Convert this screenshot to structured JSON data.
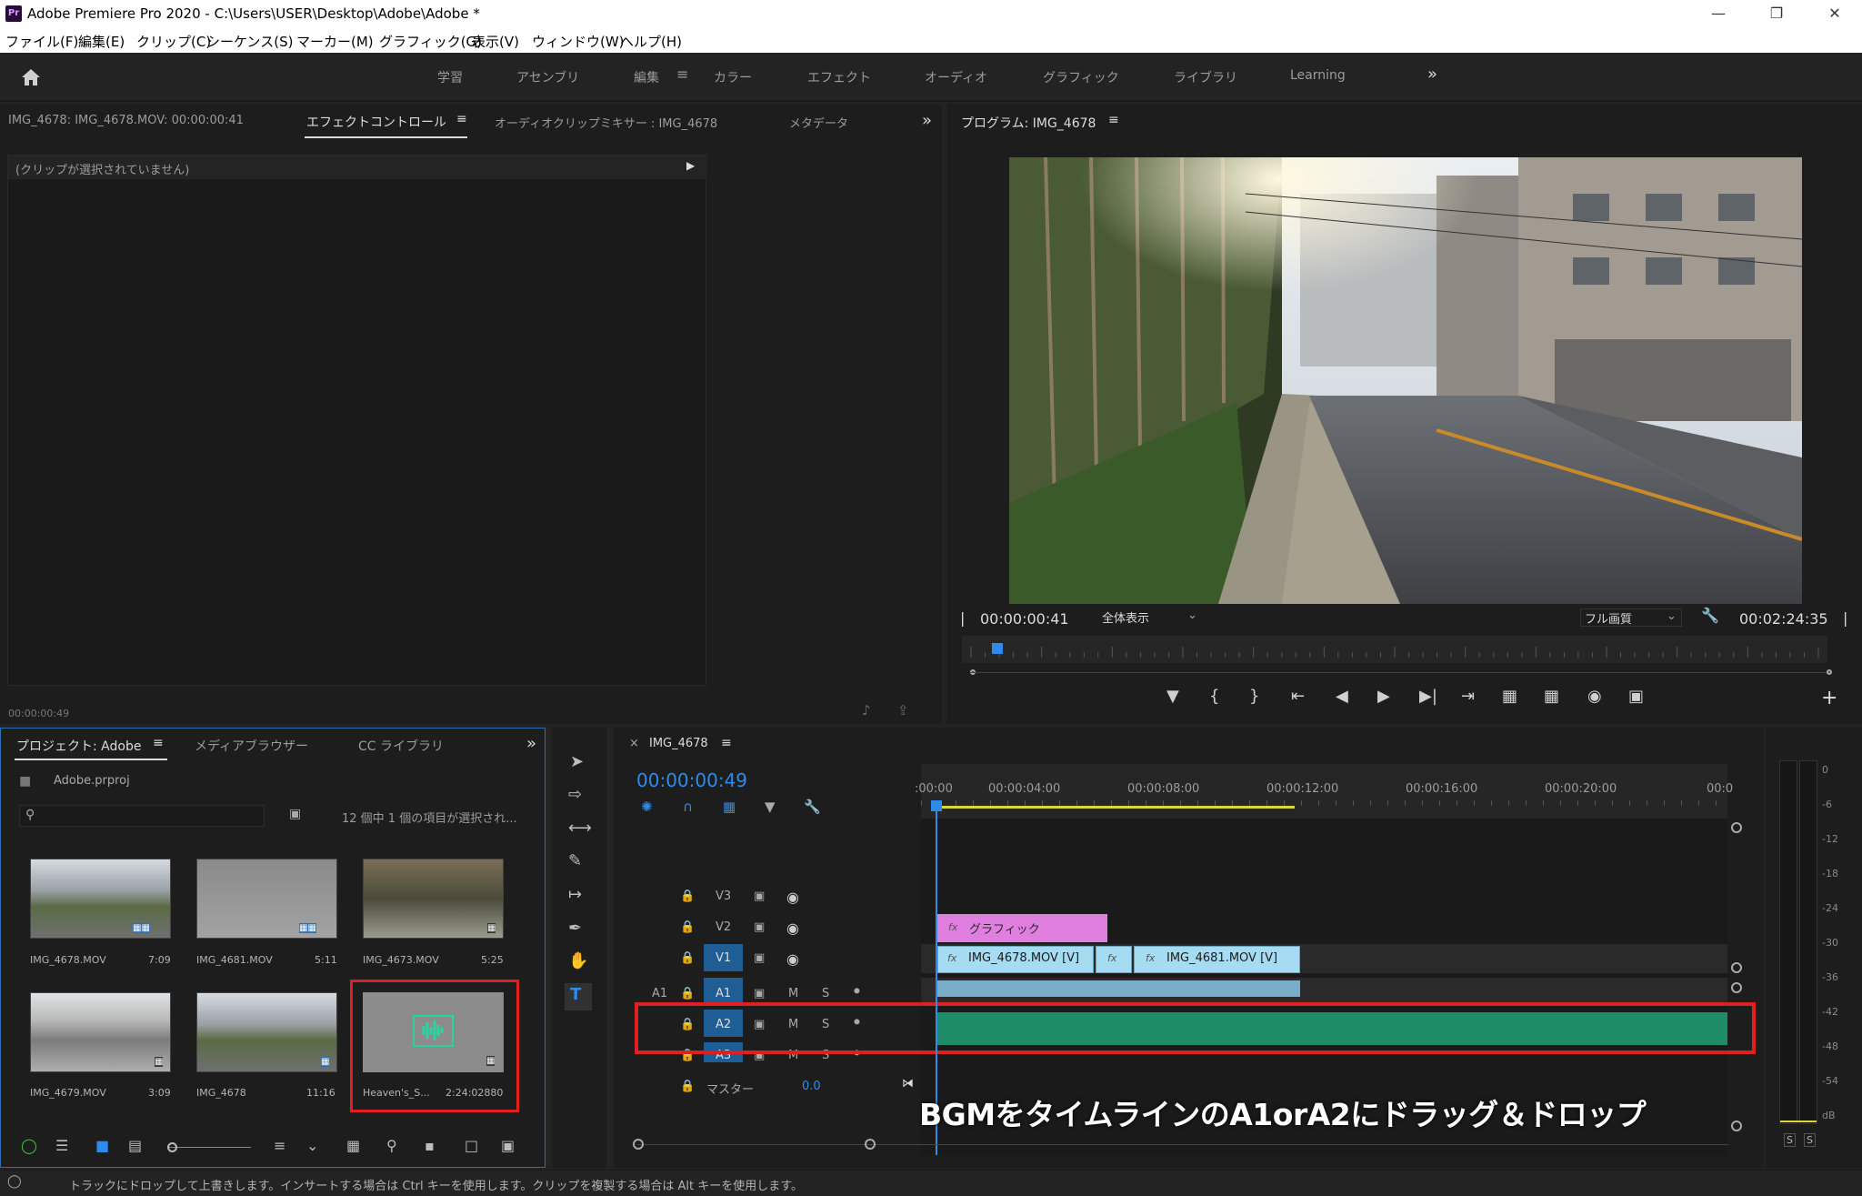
{
  "title": "Adobe Premiere Pro 2020 - C:\\Users\\USER\\Desktop\\Adobe\\Adobe *",
  "logo": "Pr",
  "menu": [
    "ファイル(F)",
    "編集(E)",
    "クリップ(C)",
    "シーケンス(S)",
    "マーカー(M)",
    "グラフィック(G)",
    "表示(V)",
    "ウィンドウ(W)",
    "ヘルプ(H)"
  ],
  "workspaces": [
    "学習",
    "アセンブリ",
    "編集",
    "カラー",
    "エフェクト",
    "オーディオ",
    "グラフィック",
    "ライブラリ",
    "Learning"
  ],
  "source": {
    "tabs": [
      "IMG_4678: IMG_4678.MOV: 00:00:00:41",
      "エフェクトコントロール",
      "オーディオクリップミキサー : IMG_4678",
      "メタデータ"
    ],
    "no_clip": "(クリップが選択されていません)",
    "timecode": "00:00:00:49"
  },
  "program": {
    "tab": "プログラム: IMG_4678",
    "timecode": "00:00:00:41",
    "zoom": "全体表示",
    "quality": "フル画質",
    "duration": "00:02:24:35",
    "playhead_fraction": 0.025
  },
  "project": {
    "tabs": [
      "プロジェクト: Adobe",
      "メディアブラウザー",
      "CC ライブラリ"
    ],
    "file": "Adobe.prproj",
    "count": "12 個中 1 個の項目が選択され...",
    "items": [
      {
        "name": "IMG_4678.MOV",
        "dur": "7:09"
      },
      {
        "name": "IMG_4681.MOV",
        "dur": "5:11"
      },
      {
        "name": "IMG_4673.MOV",
        "dur": "5:25"
      },
      {
        "name": "IMG_4679.MOV",
        "dur": "3:09"
      },
      {
        "name": "IMG_4678",
        "dur": "11:16"
      },
      {
        "name": "Heaven's_S...",
        "dur": "2:24:02880"
      }
    ]
  },
  "timeline": {
    "tab": "IMG_4678",
    "timecode": "00:00:00:49",
    "ruler": [
      ":00:00",
      "00:00:04:00",
      "00:00:08:00",
      "00:00:12:00",
      "00:00:16:00",
      "00:00:20:00",
      "00:0"
    ],
    "tracks": {
      "v3": "V3",
      "v2": "V2",
      "v1": "V1",
      "a1src": "A1",
      "a1": "A1",
      "a2": "A2",
      "a3": "A3",
      "m": "M",
      "s": "S",
      "master": "マスター",
      "master_val": "0.0"
    },
    "clips": {
      "graphic": "グラフィック",
      "v1a": "IMG_4678.MOV [V]",
      "v1b": "IMG_4681.MOV [V]"
    },
    "annotation": "BGMをタイムラインのA1orA2にドラッグ＆ドロップ"
  },
  "meter": {
    "scale": [
      "0",
      "-6",
      "-12",
      "-18",
      "-24",
      "-30",
      "-36",
      "-42",
      "-48",
      "-54",
      "dB"
    ],
    "solo": [
      "S",
      "S"
    ]
  },
  "status": "トラックにドロップして上書きします。インサートする場合は Ctrl キーを使用します。クリップを複製する場合は Alt キーを使用します。",
  "colors": {
    "accent": "#2d8ceb",
    "audio_clip": "#1f8c68",
    "video_clip": "#a6dcf2",
    "graphic_clip": "#e07fe0",
    "highlight_box": "#e02020"
  }
}
